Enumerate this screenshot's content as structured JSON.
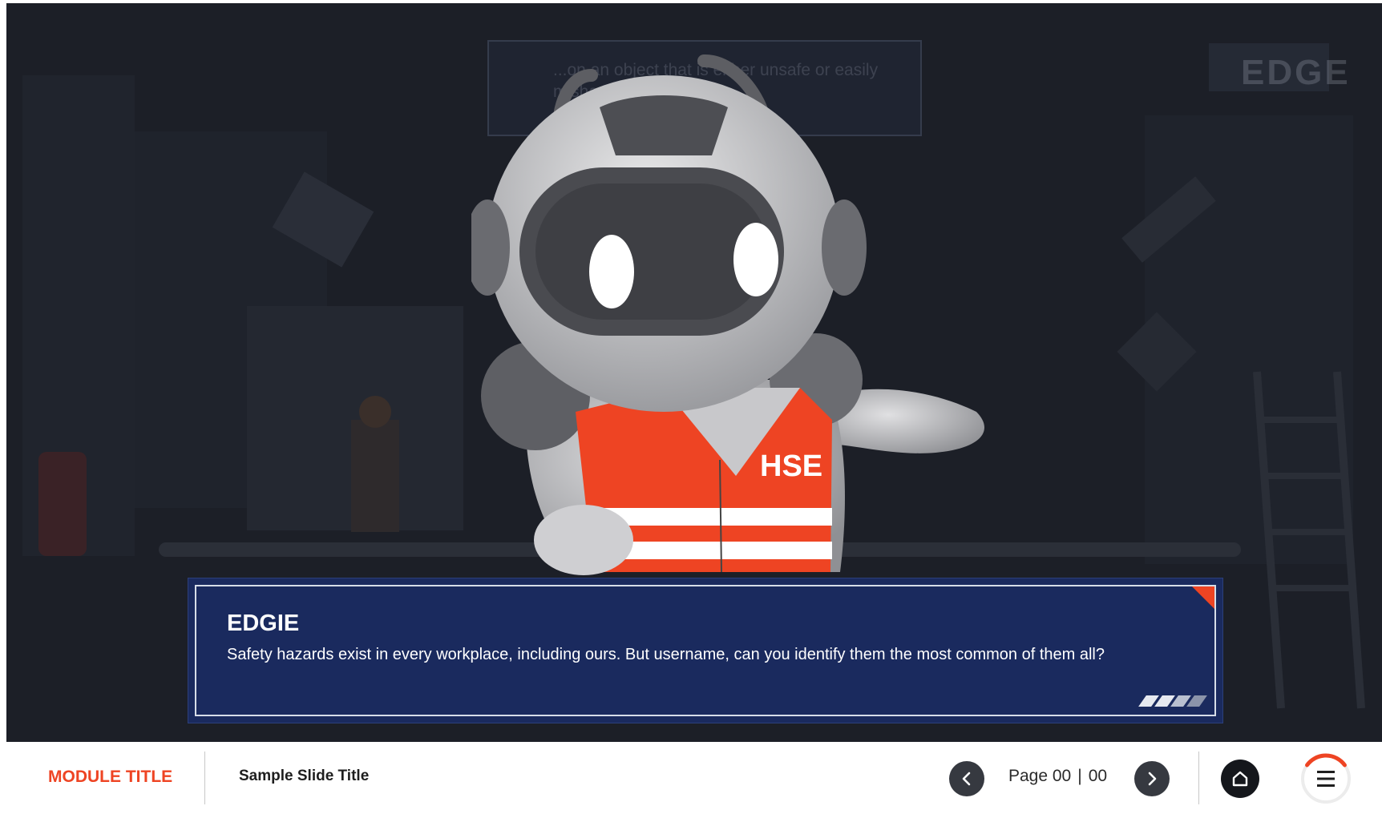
{
  "background": {
    "faded_prompt": "...on an object that is either unsafe or easily mishandled to you",
    "faded_logo": "EDGE"
  },
  "character": {
    "vest_label": "HSE"
  },
  "dialog": {
    "speaker": "EDGIE",
    "message": "Safety hazards exist in every workplace, including ours. But username, can you identify them the most common of them all?"
  },
  "footer": {
    "module_title": "MODULE TITLE",
    "slide_title": "Sample Slide Title",
    "page_label": "Page 00",
    "page_separator": "|",
    "page_total": "00",
    "prev_icon": "chevron-left-icon",
    "next_icon": "chevron-right-icon",
    "home_icon": "home-icon",
    "menu_icon": "hamburger-menu-icon",
    "menu_progress_percent": 30
  },
  "colors": {
    "accent": "#ee4423",
    "dialog_bg": "#1a2a5e",
    "stage_bg": "#1c1f27",
    "nav_button": "#363940"
  }
}
